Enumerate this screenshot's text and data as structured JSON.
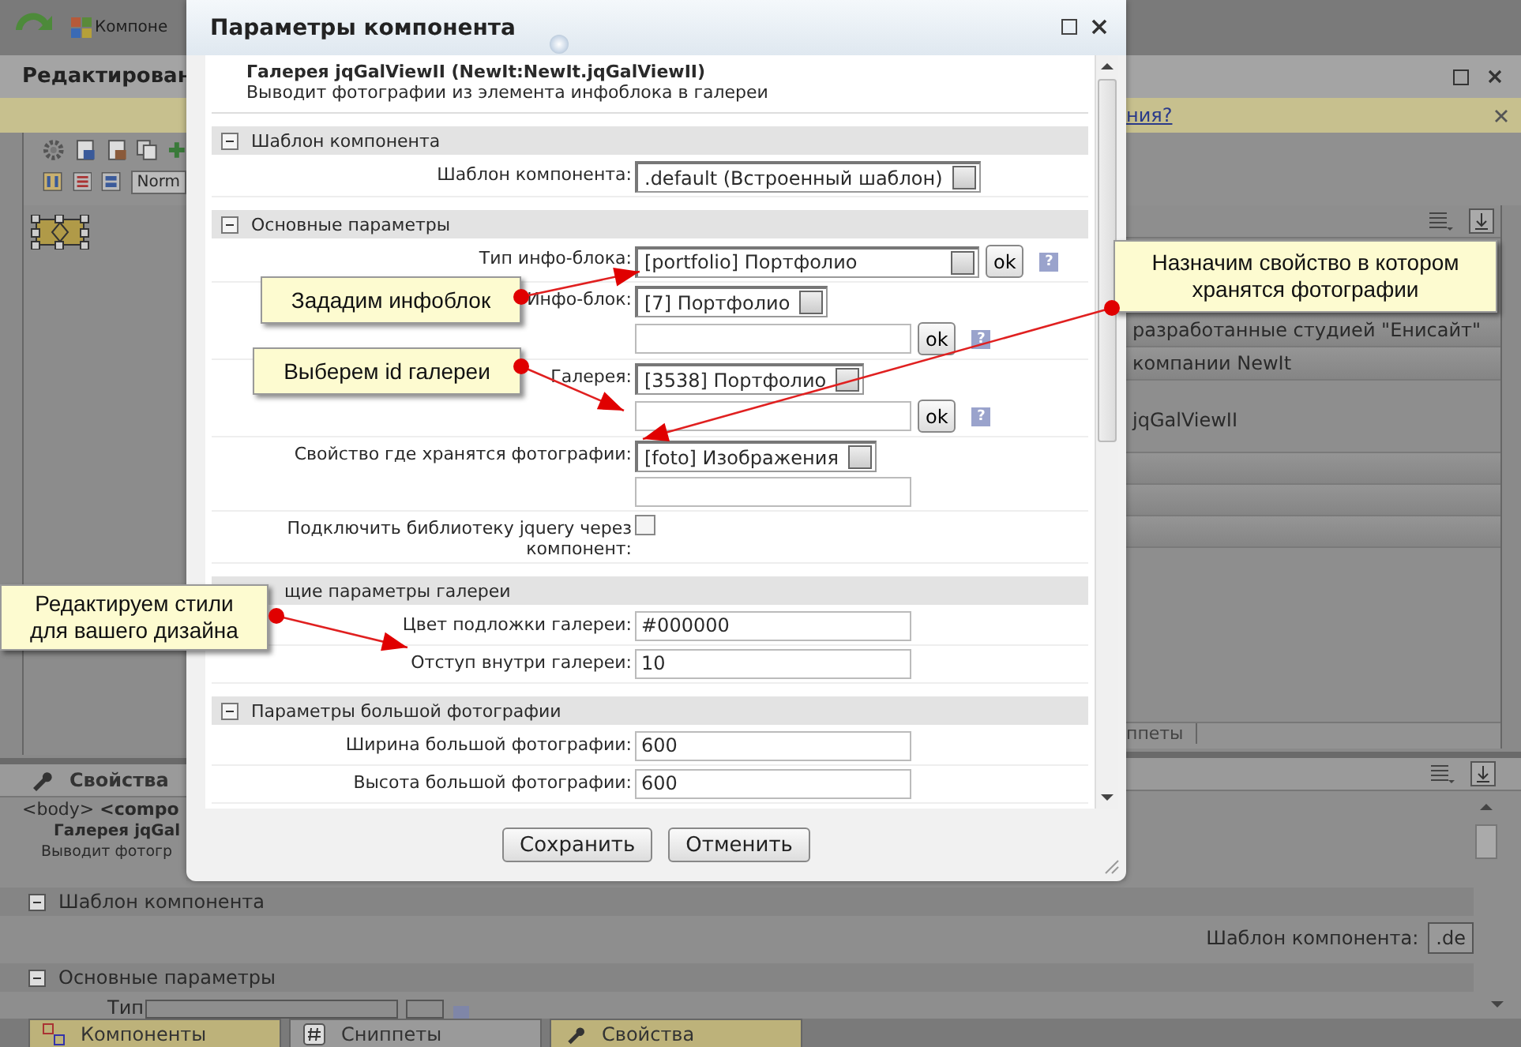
{
  "background": {
    "top_tab": "Компоне",
    "editor_title": "Редактирован",
    "notice_link": "ния?",
    "format_select": "Norm",
    "right_rows": [
      "разработанные студией \"Енисайт\"",
      "компании NewIt",
      "jqGalViewII"
    ],
    "right_tab": "ппеты",
    "props_title": "Свойства",
    "props_path": "<body> **<compo**",
    "props_name": "Галерея jqGal",
    "props_desc": "Выводит фотогр",
    "bottom": [
      {
        "kind": "section",
        "title": "Шаблон компонента"
      },
      {
        "kind": "field",
        "label": "Шаблон компонента:",
        "value": ".de"
      },
      {
        "kind": "section",
        "title": "Основные параметры"
      },
      {
        "kind": "cut",
        "label": "Тип"
      }
    ],
    "tabs": [
      {
        "label": "Компоненты",
        "selected": true
      },
      {
        "label": "Сниппеты",
        "selected": false
      },
      {
        "label": "Свойства",
        "selected": true
      }
    ]
  },
  "dialog": {
    "title": "Параметры компонента",
    "name": "Галерея jqGalViewII (NewIt:NewIt.jqGalViewII)",
    "desc": "Выводит фотографии из элемента инфоблока в галереи",
    "groups": [
      {
        "title": "Шаблон компонента",
        "toggle": true,
        "rows": [
          {
            "label": "Шаблон компонента:",
            "lines": [
              [
                {
                  "kind": "select",
                  "value": ".default (Встроенный шаблон)"
                }
              ]
            ]
          }
        ]
      },
      {
        "title": "Основные параметры",
        "toggle": true,
        "rows": [
          {
            "label": "Тип инфо-блока:",
            "lines": [
              [
                {
                  "kind": "select",
                  "value": "[portfolio] Портфолио"
                },
                {
                  "kind": "ok",
                  "label": "ok"
                },
                {
                  "kind": "help",
                  "label": "?"
                }
              ]
            ]
          },
          {
            "label": "Инфо-блок:",
            "lines": [
              [
                {
                  "kind": "select",
                  "value": "[7] Портфолио"
                }
              ],
              [
                {
                  "kind": "input"
                },
                {
                  "kind": "ok",
                  "label": "ok"
                },
                {
                  "kind": "help",
                  "label": "?"
                }
              ]
            ]
          },
          {
            "label": "Галерея:",
            "lines": [
              [
                {
                  "kind": "select",
                  "value": "[3538] Портфолио"
                }
              ],
              [
                {
                  "kind": "input"
                },
                {
                  "kind": "ok",
                  "label": "ok"
                },
                {
                  "kind": "help",
                  "label": "?"
                }
              ]
            ]
          },
          {
            "label": "Свойство где хранятся фотографии:",
            "lines": [
              [
                {
                  "kind": "select",
                  "value": "[foto] Изображения"
                }
              ],
              [
                {
                  "kind": "input"
                }
              ]
            ]
          },
          {
            "label": "Подключить библиотеку jquery через компонент:",
            "lines": [
              [
                {
                  "kind": "checkbox",
                  "checked": false
                }
              ]
            ]
          }
        ]
      },
      {
        "title": "щие параметры галереи",
        "toggle": false,
        "rows": [
          {
            "label": "Цвет подложки галереи:",
            "lines": [
              [
                {
                  "kind": "input",
                  "value": "#000000"
                }
              ]
            ]
          },
          {
            "label": "Отступ внутри галереи:",
            "lines": [
              [
                {
                  "kind": "input",
                  "value": "10"
                }
              ]
            ]
          }
        ]
      },
      {
        "title": "Параметры большой фотографии",
        "toggle": true,
        "rows": [
          {
            "label": "Ширина большой фотографии:",
            "lines": [
              [
                {
                  "kind": "input",
                  "value": "600"
                }
              ]
            ]
          },
          {
            "label": "Высота большой фотографии:",
            "lines": [
              [
                {
                  "kind": "input",
                  "value": "600"
                }
              ]
            ]
          }
        ]
      }
    ],
    "buttons": [
      "Сохранить",
      "Отменить"
    ]
  },
  "callouts": [
    {
      "text": "Зададим инфоблок"
    },
    {
      "text": "Выберем id галереи"
    },
    {
      "text": "Назначим свойство в котором хранятся фотографии"
    },
    {
      "text": "Редактируем стили для вашего дизайна"
    }
  ]
}
